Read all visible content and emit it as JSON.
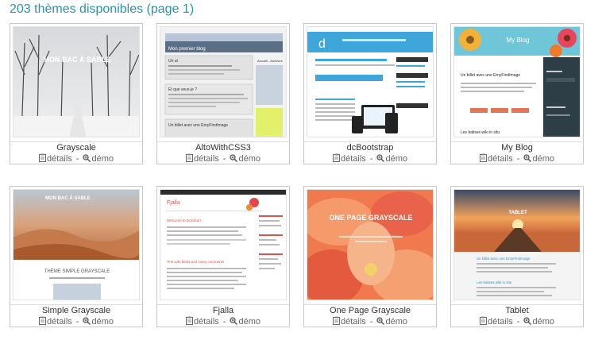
{
  "page": {
    "title": "203 thèmes disponibles (page 1)"
  },
  "labels": {
    "details": "détails",
    "demo": "démo",
    "separator": "-"
  },
  "themes": [
    {
      "name": "Grayscale",
      "thumb_text": [
        "MON BAC À SABLE"
      ]
    },
    {
      "name": "AltoWithCSS3",
      "thumb_text": [
        "Mon premier blog",
        "Un ut",
        "Et que veux-je ?",
        "Un billet avec une ErnyFirstImage",
        "Accueil - Archives"
      ]
    },
    {
      "name": "dcBootstrap",
      "thumb_text": [
        "d"
      ]
    },
    {
      "name": "My Blog",
      "thumb_text": [
        "My Blog",
        "Un billet avec une ErnyFirstImage",
        "Les balises wiki in situ"
      ]
    },
    {
      "name": "Simple Grayscale",
      "thumb_text": [
        "MON BAC À SABLE",
        "THÈME SIMPLE GRAYSCALE"
      ]
    },
    {
      "name": "Fjalla",
      "thumb_text": [
        "Fjalla",
        "Welcome to Dotclear!",
        "Test with fields and many comments"
      ]
    },
    {
      "name": "One Page Grayscale",
      "thumb_text": [
        "ONE PAGE GRAYSCALE"
      ]
    },
    {
      "name": "Tablet",
      "thumb_text": [
        "TABLET",
        "Un billet avec une ErnyFirstImage",
        "Les balises wiki in situ"
      ]
    }
  ],
  "colors": {
    "title": "#2a93a9",
    "card_border": "#c9c9c9",
    "link": "#666666"
  }
}
